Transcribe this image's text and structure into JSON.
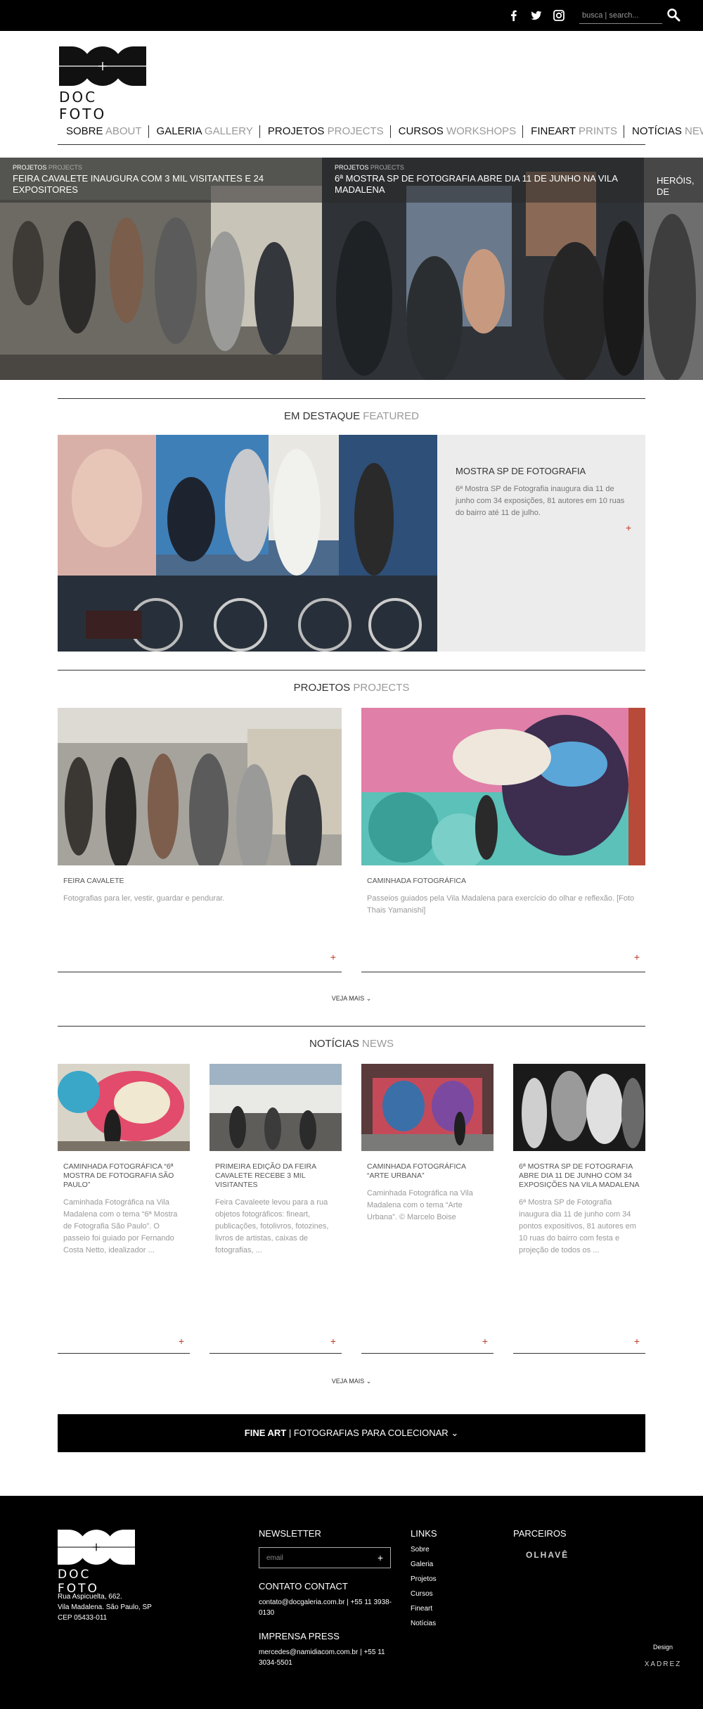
{
  "search": {
    "placeholder": "busca | search..."
  },
  "social": {
    "facebook": "f",
    "twitter": "t",
    "instagram": "ig"
  },
  "brand": {
    "name": "DOC FOTO"
  },
  "nav": [
    {
      "pt": "SOBRE",
      "en": "ABOUT"
    },
    {
      "pt": "GALERIA",
      "en": "GALLERY"
    },
    {
      "pt": "PROJETOS",
      "en": "PROJECTS"
    },
    {
      "pt": "CURSOS",
      "en": "WORKSHOPS"
    },
    {
      "pt": "FINEART",
      "en": "PRINTS"
    },
    {
      "pt": "NOTÍCIAS",
      "en": "NEWS"
    }
  ],
  "slider": [
    {
      "cat_pt": "PROJETOS",
      "cat_en": "PROJECTS",
      "title": "FEIRA CAVALETE INAUGURA COM 3 MIL VISITANTES E 24 EXPOSITORES"
    },
    {
      "cat_pt": "PROJETOS",
      "cat_en": "PROJECTS",
      "title": "6ª MOSTRA SP DE FOTOGRAFIA ABRE DIA 11 DE JUNHO NA VILA MADALENA"
    },
    {
      "cat_pt": "",
      "cat_en": "",
      "title": "HERÓIS, DE"
    }
  ],
  "featured_section": {
    "pt": "EM DESTAQUE",
    "en": "FEATURED"
  },
  "featured": {
    "title": "MOSTRA SP DE FOTOGRAFIA",
    "body": "6ª Mostra SP de Fotografia inaugura dia 11 de junho com 34 exposições, 81 autores em 10 ruas do bairro até 11 de julho.",
    "plus": "+"
  },
  "projects_section": {
    "pt": "PROJETOS",
    "en": "PROJECTS"
  },
  "projects": [
    {
      "title": "FEIRA CAVALETE",
      "body": "Fotografias para ler, vestir, guardar e pendurar.",
      "plus": "+"
    },
    {
      "title": "CAMINHADA FOTOGRÁFICA",
      "body": "Passeios guiados pela Vila Madalena para exercício do olhar e reflexão. [Foto Thais Yamanishi]",
      "plus": "+"
    }
  ],
  "more_label": "VEJA MAIS",
  "news_section": {
    "pt": "NOTÍCIAS",
    "en": "NEWS"
  },
  "news": [
    {
      "title": "CAMINHADA FOTOGRÁFICA “6ª MOSTRA DE FOTOGRAFIA SÃO PAULO”",
      "body": "Caminhada Fotográfica na Vila Madalena com o tema “6ª Mostra de Fotografia São Paulo”. O passeio foi guiado por Fernando Costa Netto, idealizador ...",
      "plus": "+"
    },
    {
      "title": "PRIMEIRA EDIÇÃO DA FEIRA CAVALETE RECEBE 3 MIL VISITANTES",
      "body": "Feira Cavaleete levou para a rua objetos fotográficos: fineart, publicações, fotolivros, fotozines, livros de artistas, caixas de fotografias, ...",
      "plus": "+"
    },
    {
      "title": "CAMINHADA FOTOGRÁFICA “ARTE URBANA”",
      "body": "Caminhada Fotográfica na Vila Madalena com o tema “Arte Urbana”. © Marcelo Boise",
      "plus": "+"
    },
    {
      "title": "6ª MOSTRA SP DE FOTOGRAFIA ABRE DIA 11 DE JUNHO COM 34 EXPOSIÇÕES NA VILA MADALENA",
      "body": "6ª Mostra SP de Fotografia inaugura dia 11 de junho com 34 pontos expositivos, 81 autores em 10 ruas do bairro com festa e projeção de todos os ...",
      "plus": "+"
    }
  ],
  "fineart_bar": {
    "strong": "FINE ART",
    "rest": "FOTOGRAFIAS PARA COLECIONAR"
  },
  "footer": {
    "address": [
      "Rua Aspicuelta, 662.",
      "Vila Madalena. São Paulo, SP",
      "CEP 05433-011"
    ],
    "newsletter_title": "NEWSLETTER",
    "newsletter_placeholder": "email",
    "contact_title": "CONTATO CONTACT",
    "contact_text": "contato@docgaleria.com.br | +55 11 3938-0130",
    "press_title": "IMPRENSA PRESS",
    "press_text": "mercedes@namidiacom.com.br | +55 11 3034-5501",
    "links_title": "LINKS",
    "links": [
      "Sobre",
      "Galeria",
      "Projetos",
      "Cursos",
      "Fineart",
      "Notícias"
    ],
    "partners_title": "PARCEIROS",
    "partner": "OLHAVÊ",
    "design_label": "Design",
    "design_by": "XADREZ"
  }
}
